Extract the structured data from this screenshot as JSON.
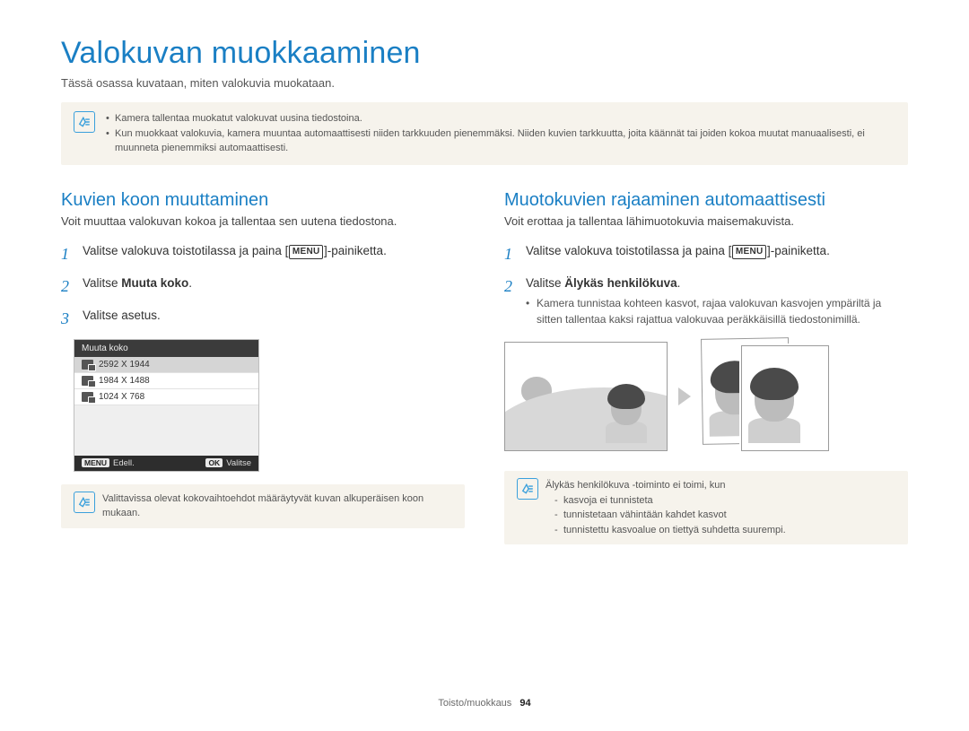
{
  "title": "Valokuvan muokkaaminen",
  "intro": "Tässä osassa kuvataan, miten valokuvia muokataan.",
  "top_note": {
    "items": [
      "Kamera tallentaa muokatut valokuvat uusina tiedostoina.",
      "Kun muokkaat valokuvia, kamera muuntaa automaattisesti niiden tarkkuuden pienemmäksi. Niiden kuvien tarkkuutta, joita käännät tai joiden kokoa muutat manuaalisesti, ei muunneta pienemmiksi automaattisesti."
    ]
  },
  "left": {
    "heading": "Kuvien koon muuttaminen",
    "lead": "Voit muuttaa valokuvan kokoa ja tallentaa sen uutena tiedostona.",
    "step1_pre": "Valitse valokuva toistotilassa ja paina [",
    "step1_chip": "MENU",
    "step1_post": "]-painiketta.",
    "step2_pre": "Valitse ",
    "step2_bold": "Muuta koko",
    "step2_post": ".",
    "step3": "Valitse asetus.",
    "screen": {
      "title": "Muuta koko",
      "rows": [
        "2592 X 1944",
        "1984 X 1488",
        "1024 X 768"
      ],
      "footer_left_tag": "MENU",
      "footer_left": "Edell.",
      "footer_right_tag": "OK",
      "footer_right": "Valitse"
    },
    "note": "Valittavissa olevat kokovaihtoehdot määräytyvät kuvan alkuperäisen koon mukaan."
  },
  "right": {
    "heading": "Muotokuvien rajaaminen automaattisesti",
    "lead": "Voit erottaa ja tallentaa lähimuotokuvia maisemakuvista.",
    "step1_pre": "Valitse valokuva toistotilassa ja paina [",
    "step1_chip": "MENU",
    "step1_post": "]-painiketta.",
    "step2_pre": "Valitse ",
    "step2_bold": "Älykäs henkilökuva",
    "step2_post": ".",
    "step2_bullet": "Kamera tunnistaa kohteen kasvot, rajaa valokuvan kasvojen ympäriltä ja sitten tallentaa kaksi rajattua valokuvaa peräkkäisillä tiedostonimillä.",
    "note_lead": "Älykäs henkilökuva -toiminto ei toimi, kun",
    "note_items": [
      "kasvoja ei tunnisteta",
      "tunnistetaan vähintään kahdet kasvot",
      "tunnistettu kasvoalue on tiettyä suhdetta suurempi."
    ]
  },
  "footer": {
    "section": "Toisto/muokkaus",
    "page": "94"
  }
}
